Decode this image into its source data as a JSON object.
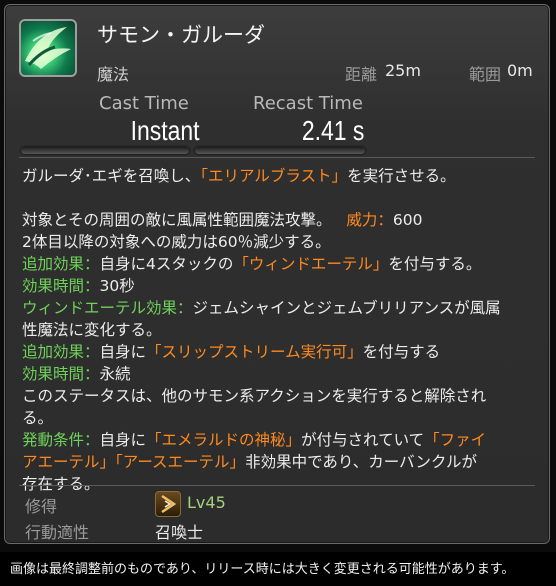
{
  "action": {
    "name": "サモン・ガルーダ",
    "type": "魔法",
    "range_label": "距離",
    "range_value": "25m",
    "radius_label": "範囲",
    "radius_value": "0m"
  },
  "timing": {
    "cast_label": "Cast Time",
    "cast_value": "Instant",
    "recast_label": "Recast Time",
    "recast_value": "2.41 s"
  },
  "description": {
    "l1_a": "ガルーダ･エギを召喚し、",
    "l1_b": "「エリアルブラスト」",
    "l1_c": "を実行させる。",
    "l2_a": "対象とその周囲の敵に風属性範囲魔法攻撃。",
    "l2_b": "威力：",
    "l2_c": "600",
    "l3": "2体目以降の対象への威力は60％減少する。",
    "l4_a": "追加効果：",
    "l4_b": "自身に4スタックの",
    "l4_c": "「ウィンドエーテル」",
    "l4_d": "を付与する。",
    "l5_a": "効果時間：",
    "l5_b": "30秒",
    "l6_a": "ウィンドエーテル効果：",
    "l6_b": "ジェムシャインとジェムブリリアンスが風属",
    "l7": "性魔法に変化する。",
    "l8_a": "追加効果：",
    "l8_b": "自身に",
    "l8_c": "「スリップストリーム実行可」",
    "l8_d": "を付与する",
    "l9_a": "効果時間：",
    "l9_b": "永続",
    "l10": "このステータスは、他のサモン系アクションを実行すると解除され",
    "l11": "る。",
    "l12_a": "発動条件：",
    "l12_b": "自身に",
    "l12_c": "「エメラルドの神秘」",
    "l12_d": "が付与されていて",
    "l12_e": "「ファイ",
    "l13_a": "アエーテル」",
    "l13_b": "「アースエーテル」",
    "l13_c": "非効果中であり、カーバンクルが",
    "l14": "存在する。"
  },
  "meta": {
    "acquire_label": "修得",
    "level": "Lv45",
    "class_label": "行動適性",
    "class_value": "召喚士"
  },
  "notice": "画像は最終調整前のものであり、リリース時には大きく変更される可能性があります。",
  "colors": {
    "highlight_green": "#6fd35a",
    "highlight_orange": "#ff8a1f",
    "level_green": "#a5d27d"
  },
  "icons": {
    "action_icon": "garuda-wind-icon",
    "job_icon": "summoner-job-icon"
  }
}
